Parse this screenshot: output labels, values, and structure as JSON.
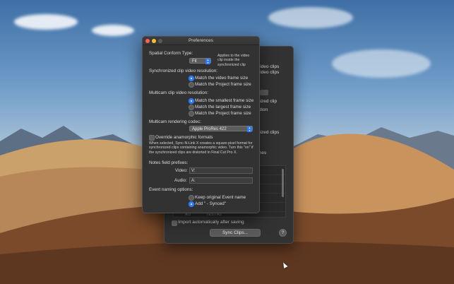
{
  "colors": {
    "window_bg": "#323232",
    "accent": "#2f7df6",
    "close": "#ff5f56",
    "minimize": "#ffbd2e",
    "zoom": "#5a5a5a"
  },
  "background_window": {
    "partial_texts": [
      "video clips",
      "video clips",
      "nized clip",
      "ation",
      "nized clips",
      "mes"
    ],
    "list_visible_text": [
      "A/2",
      "TEST A2"
    ],
    "import_checkbox_label": "Import automatically after saving",
    "import_checked": true,
    "sync_button": "Sync Clips...",
    "help_button": "?"
  },
  "prefs": {
    "title": "Preferences",
    "spatial": {
      "label": "Spatial Conform Type:",
      "value": "Fit",
      "note": "Applies to the video clip inside the synchronized clip"
    },
    "sync_res": {
      "label": "Synchronized clip video resolution:",
      "options": [
        "Match the video frame size",
        "Match the Project frame size"
      ],
      "selected": 0
    },
    "multicam_res": {
      "label": "Multicam clip video resolution:",
      "options": [
        "Match the smallest frame size",
        "Match the largest frame size",
        "Match the Project frame size"
      ],
      "selected": 0
    },
    "codec": {
      "label": "Multicam rendering codec:",
      "value": "Apple ProRes 422"
    },
    "anamorphic": {
      "label": "Override anamorphic formats",
      "checked": false,
      "note": "When selected, Sync-N-Link X creates a square-pixel format for synchronized clips containing anamorphic video. Turn this \"on\" if the synchronized clips are distorted in Final Cut Pro X."
    },
    "notes": {
      "label": "Notes field prefixes:",
      "video_label": "Video:",
      "video_value": "V:",
      "audio_label": "Audio:",
      "audio_value": "A:"
    },
    "event": {
      "label": "Event naming options:",
      "options": [
        "Keep original Event name",
        "Add \" - Synced\""
      ],
      "selected": 1
    }
  }
}
